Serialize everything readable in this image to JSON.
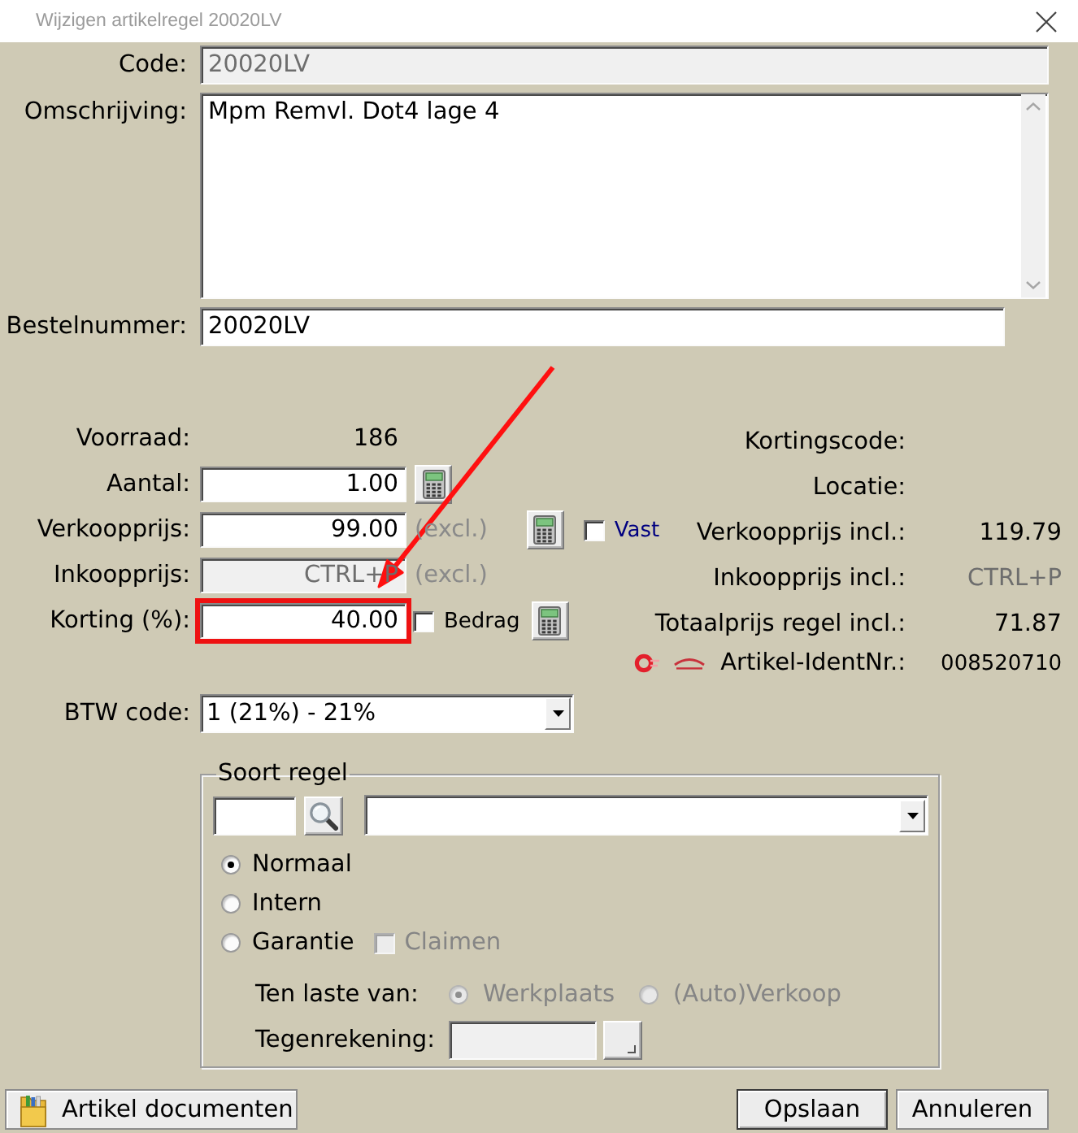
{
  "window": {
    "title": "Wijzigen artikelregel 20020LV"
  },
  "header_fields": [
    {
      "kind": "field",
      "label": "Code:",
      "value": "20020LV",
      "disabled": true
    },
    {
      "kind": "textarea",
      "label": "Omschrijving:",
      "value": "Mpm Remvl. Dot4 lage 4",
      "disabled": false
    },
    {
      "kind": "field",
      "label": "Bestelnummer:",
      "value": "20020LV",
      "disabled": false
    }
  ],
  "stock": {
    "label": "Voorraad:",
    "value": "186"
  },
  "price_fields": [
    {
      "label": "Aantal:",
      "value": "1.00",
      "disabled": false,
      "highlighted": false,
      "extras": [
        {
          "kind": "calculator"
        }
      ]
    },
    {
      "label": "Verkoopprijs:",
      "value": "99.00",
      "disabled": false,
      "highlighted": false,
      "extras": [
        {
          "kind": "suffix",
          "text": "(excl.)"
        },
        {
          "kind": "calculator"
        },
        {
          "kind": "checkbox",
          "label": "Vast",
          "checked": false,
          "color": "#000080"
        }
      ]
    },
    {
      "label": "Inkoopprijs:",
      "value": "CTRL+P",
      "disabled": true,
      "highlighted": false,
      "extras": [
        {
          "kind": "suffix",
          "text": "(excl.)"
        }
      ]
    },
    {
      "label": "Korting (%):",
      "value": "40.00",
      "disabled": false,
      "highlighted": true,
      "extras": [
        {
          "kind": "checkbox",
          "label": "Bedrag",
          "checked": false,
          "color": "#000000"
        },
        {
          "kind": "calculator"
        }
      ]
    }
  ],
  "totals": [
    {
      "kind": "plain",
      "label": "Kortingscode:"
    },
    {
      "kind": "plain",
      "label": "Locatie:"
    },
    {
      "kind": "plain",
      "label": "Verkoopprijs incl.:",
      "value": "119.79",
      "dimmed": false
    },
    {
      "kind": "plain",
      "label": "Inkoopprijs incl.:",
      "value": "CTRL+P",
      "dimmed": true
    },
    {
      "kind": "plain",
      "label": "Totaalprijs regel incl.:",
      "value": "71.87",
      "dimmed": false
    },
    {
      "kind": "ident",
      "label": "Artikel-IdentNr.:",
      "value": "008520710",
      "dimmed": false
    }
  ],
  "btw": {
    "label": "BTW code:",
    "value": "1 (21%) - 21%"
  },
  "soort_regel": {
    "legend": "Soort regel",
    "options": [
      {
        "label": "Normaal",
        "selected": true
      },
      {
        "label": "Intern",
        "selected": false
      },
      {
        "label": "Garantie",
        "selected": false,
        "checkbox": {
          "label": "Claimen",
          "checked": false,
          "disabled": true
        }
      }
    ],
    "ten_laste_van": {
      "label": "Ten laste van:",
      "disabled": true,
      "options": [
        {
          "label": "Werkplaats",
          "selected": true
        },
        {
          "label": "(Auto)Verkoop",
          "selected": false
        }
      ]
    },
    "tegenrekening": {
      "label": "Tegenrekening:",
      "disabled": true
    }
  },
  "buttons": [
    {
      "kind": "documents",
      "label": "Artikel documenten"
    },
    {
      "kind": "default",
      "label": "Opslaan"
    },
    {
      "kind": "normal",
      "label": "Annuleren"
    }
  ],
  "annotation": {
    "arrow": true
  }
}
